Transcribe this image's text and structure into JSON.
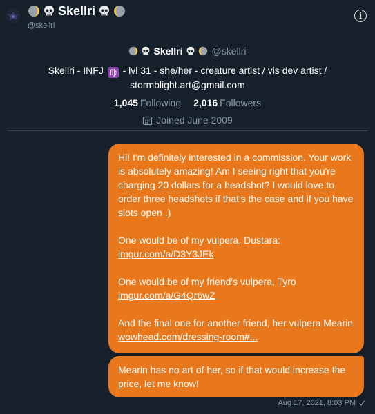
{
  "header": {
    "display_name": "Skellri",
    "handle": "@skellri",
    "info_icon": "info-icon",
    "info_glyph": "i"
  },
  "profile": {
    "display_name": "Skellri",
    "handle": "@skellri",
    "bio_part1": "Skellri - INFJ",
    "bio_virgo": "♍",
    "bio_part2": "- lvl 31 - she/her - creature artist / vis dev artist / stormblight.art@gmail.com",
    "following_count": "1,045",
    "following_label": "Following",
    "followers_count": "2,016",
    "followers_label": "Followers",
    "joined": "Joined June 2009"
  },
  "messages": [
    {
      "p1": "Hi! I'm definitely interested in a commission. Your work is absolutely amazing! Am I seeing right that you're charging 20 dollars for a headshot? I would love to order three headshots if that's the case and if you have slots open .)",
      "p2": "One would be of my vulpera, Dustara:",
      "link1": "imgur.com/a/D3Y3JEk",
      "p3": "One would be of my friend's vulpera, Tyro",
      "link2": "imgur.com/a/G4Qr6wZ",
      "p4": "And the final one for another friend, her vulpera Mearin",
      "link3": "wowhead.com/dressing-room#..."
    },
    {
      "text": "Mearin has no art of her, so if that would increase the price, let me know!"
    }
  ],
  "timestamp": "Aug 17, 2021, 8:03 PM",
  "colors": {
    "background": "#15202b",
    "bubble": "#e9781d",
    "muted": "#8b98a5"
  }
}
